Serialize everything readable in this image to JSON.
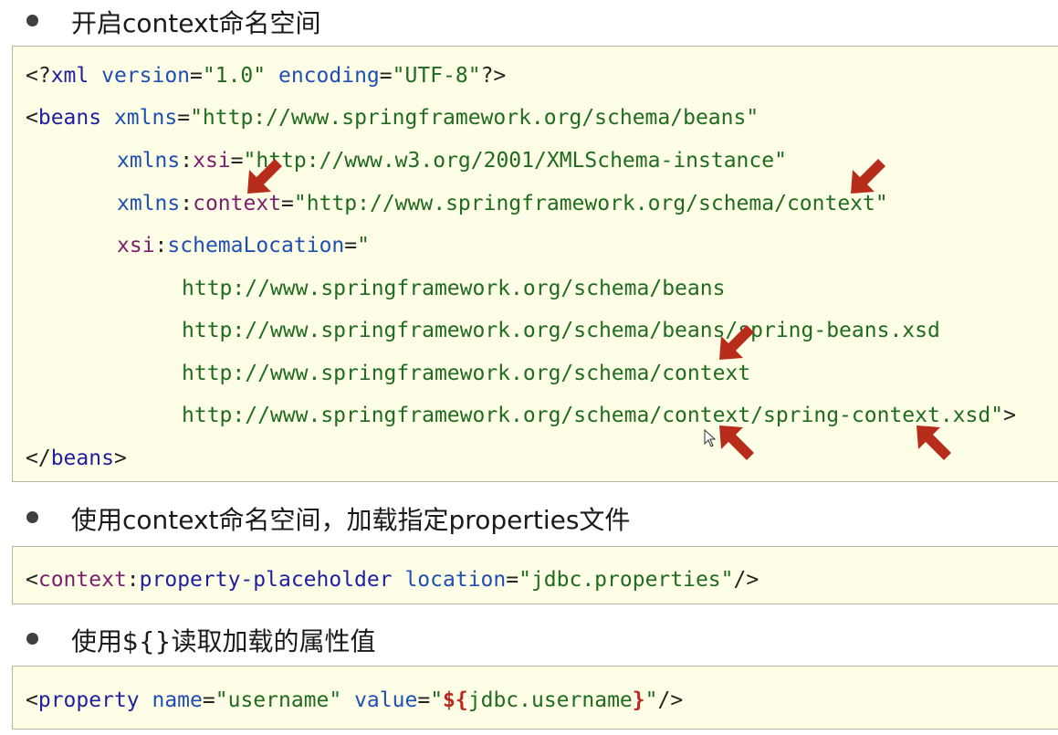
{
  "sections": [
    {
      "bullet": "开启context命名空间"
    },
    {
      "bullet": "使用context命名空间，加载指定properties文件"
    },
    {
      "bullet": "使用${}读取加载的属性值"
    }
  ],
  "code1": {
    "l1": {
      "a": "<?",
      "b": "xml",
      "c": " version",
      "d": "=",
      "e": "\"1.0\"",
      "f": " encoding",
      "g": "=",
      "h": "\"UTF-8\"",
      "i": "?>"
    },
    "l2": {
      "a": "<",
      "b": "beans",
      "c": " xmlns",
      "d": "=",
      "e": "\"http://www.springframework.org/schema/beans\""
    },
    "l3": {
      "a": "xmlns",
      "b": ":",
      "c": "xsi",
      "d": "=",
      "e": "\"http://www.w3.org/2001/XMLSchema-instance\""
    },
    "l4": {
      "a": "xmlns",
      "b": ":",
      "c": "context",
      "d": "=",
      "e": "\"http://www.springframework.org/schema/context\""
    },
    "l5": {
      "a": "xsi",
      "b": ":",
      "c": "schemaLocation",
      "d": "=",
      "e": "\""
    },
    "l6": "http://www.springframework.org/schema/beans",
    "l7": "http://www.springframework.org/schema/beans/spring-beans.xsd",
    "l8": "http://www.springframework.org/schema/context",
    "l9": {
      "a": "http://www.springframework.org/schema/context/spring-context.xsd\"",
      "b": ">"
    },
    "l10": {
      "a": "</",
      "b": "beans",
      "c": ">"
    }
  },
  "code2": {
    "a": "<",
    "b": "context",
    "c": ":",
    "d": "property-placeholder",
    "e": " location",
    "f": "=",
    "g": "\"jdbc.properties\"",
    "h": "/>"
  },
  "code3": {
    "a": "<",
    "b": "property",
    "c": " name",
    "d": "=",
    "e": "\"username\"",
    "f": " value",
    "g": "=",
    "h": "\"",
    "i": "${",
    "j": "jdbc.username",
    "k": "}",
    "l": "\"",
    "m": "/>"
  },
  "colors": {
    "box_bg": "#fefee6",
    "arrow": "#b82c1c",
    "string": "#1f6b1f",
    "tag": "#1f1f9f",
    "namespace": "#7a1f6e"
  },
  "icons": [
    "red-arrow-icon",
    "mouse-cursor-icon",
    "bullet-dot-icon"
  ]
}
